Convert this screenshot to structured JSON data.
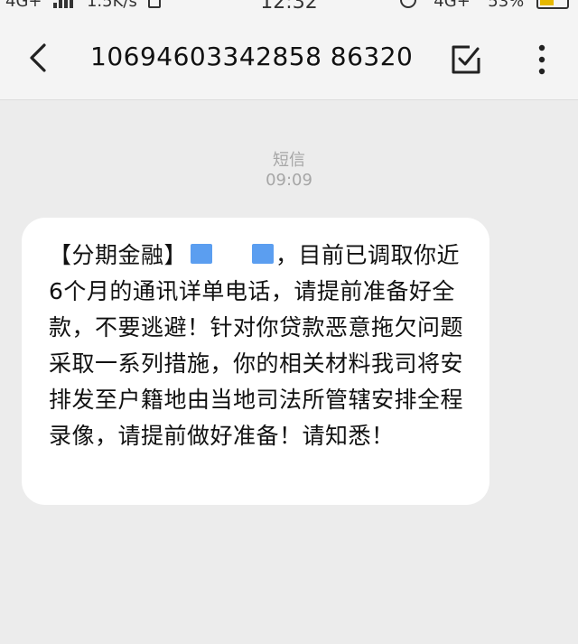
{
  "status_bar": {
    "network": "4G+",
    "speed": "1.5K/s",
    "time": "12:32",
    "mobile": "4G+",
    "battery": "53%",
    "battery_level": 0.53
  },
  "header": {
    "title": "10694603342858 86320",
    "back_icon": "chevron-left-icon",
    "select_icon": "checkbox-icon",
    "more_icon": "more-vertical-icon"
  },
  "conversation": {
    "message_type": "短信",
    "message_time": "09:09",
    "message": {
      "prefix": "【分期金融】",
      "redacted_1": "",
      "redacted_2": "",
      "body": "，目前已调取你近6个月的通讯详单电话，请提前准备好全款，不要逃避！针对你贷款恶意拖欠问题采取一系列措施，你的相关材料我司将安排发至户籍地由当地司法所管辖安排全程录像，请提前做好准备！请知悉！"
    }
  },
  "colors": {
    "background": "#ececec",
    "header": "#f4f4f4",
    "bubble": "#ffffff",
    "redaction": "#5b9ef0",
    "meta_text": "#a6a6a6"
  }
}
